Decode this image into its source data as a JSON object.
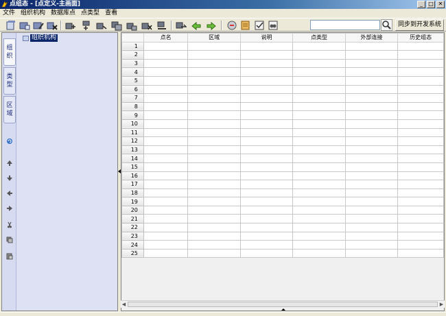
{
  "window": {
    "title": "点组态 - [点定义-主画面]",
    "min": "_",
    "max": "□",
    "close": "✕"
  },
  "menu": [
    "文件",
    "组织机构",
    "数据库点",
    "点类型",
    "查看"
  ],
  "toolbar": {
    "buttons": [
      "open-icon",
      "add-folder-icon",
      "edit-icon",
      "delete-icon",
      "add-point-icon",
      "add-batch-icon",
      "move-icon",
      "copy-point-icon",
      "paste-point-icon",
      "remove-point-icon",
      "insert-icon",
      "export-icon",
      "import-icon",
      "refresh-icon",
      "database-icon",
      "check-icon",
      "binoculars-icon"
    ],
    "search_placeholder": "",
    "search_icon": "search-icon",
    "sync_label": "同步到开发系统"
  },
  "sidebar": {
    "tabs": [
      {
        "chars": [
          "组",
          "织"
        ]
      },
      {
        "chars": [
          "类",
          "型"
        ]
      },
      {
        "chars": [
          "区",
          "域"
        ]
      }
    ],
    "icons": [
      "refresh-icon",
      "arrow-up-icon",
      "arrow-down-icon",
      "arrow-left-icon",
      "arrow-right-icon",
      "cut-icon",
      "copy-icon",
      "paste-icon"
    ],
    "tree_root": "组织机构"
  },
  "grid": {
    "columns": [
      "点名",
      "区域",
      "说明",
      "点类型",
      "外部连接",
      "历史组态"
    ],
    "rows": [
      "1",
      "2",
      "3",
      "4",
      "5",
      "6",
      "7",
      "8",
      "9",
      "10",
      "11",
      "12",
      "13",
      "14",
      "15",
      "16",
      "17",
      "18",
      "19",
      "20",
      "21",
      "22",
      "23",
      "24",
      "25"
    ]
  }
}
